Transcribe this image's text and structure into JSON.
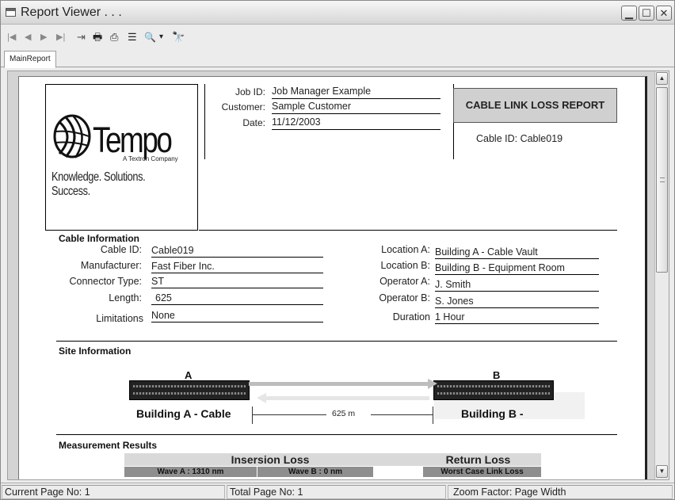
{
  "window": {
    "title": "Report Viewer . . ."
  },
  "toolbar": {
    "icons": [
      "first-page-icon",
      "prev-page-icon",
      "next-page-icon",
      "last-page-icon",
      "goto-page-icon",
      "print-icon",
      "export-icon",
      "tree-toggle-icon",
      "zoom-icon",
      "search-icon"
    ],
    "first": "|◀",
    "prev": "◀",
    "next": "▶",
    "last": "▶|",
    "goto": "⇥",
    "print": "🖶",
    "export": "⎙",
    "tree": "☰",
    "zoom": "🔍",
    "zoom_dd": "▾",
    "find": "🔭"
  },
  "tabs": {
    "main": "MainReport"
  },
  "report": {
    "header": {
      "logo": {
        "name": "Tempo",
        "sub": "A Textron Company",
        "tagline": "Knowledge. Solutions. Success."
      },
      "job_id_label": "Job ID:",
      "job_id": "Job Manager Example",
      "customer_label": "Customer:",
      "customer": "Sample Customer",
      "date_label": "Date:",
      "date": "11/12/2003",
      "title": "CABLE LINK LOSS REPORT",
      "cable_id_line": "Cable ID: Cable019"
    },
    "cable_info": {
      "title": "Cable Information",
      "left": [
        {
          "label": "Cable ID:",
          "value": "Cable019"
        },
        {
          "label": "Manufacturer:",
          "value": "Fast Fiber Inc."
        },
        {
          "label": "Connector Type:",
          "value": "ST"
        },
        {
          "label": "Length:",
          "value": "625"
        },
        {
          "label": "Limitations",
          "value": "None"
        }
      ],
      "right": [
        {
          "label": "Location A:",
          "value": "Building A - Cable Vault"
        },
        {
          "label": "Location B:",
          "value": "Building B - Equipment Room"
        },
        {
          "label": "Operator A:",
          "value": "J. Smith"
        },
        {
          "label": "Operator B:",
          "value": "S. Jones"
        },
        {
          "label": "Duration",
          "value": "1 Hour"
        }
      ]
    },
    "site_info": {
      "title": "Site Information",
      "a_label": "A",
      "b_label": "B",
      "a_building": "Building A - Cable",
      "b_building": "Building B -",
      "distance": "625 m"
    },
    "measurement": {
      "title": "Measurement Results",
      "insertion_loss": "Insersion Loss",
      "return_loss": "Return Loss",
      "wave_a": "Wave A : 1310 nm",
      "wave_b": "Wave B : 0 nm",
      "worst_case": "Worst Case Link Loss"
    }
  },
  "status": {
    "current_page": "Current Page No: 1",
    "total_page": "Total Page No: 1",
    "zoom": "Zoom Factor: Page Width"
  }
}
